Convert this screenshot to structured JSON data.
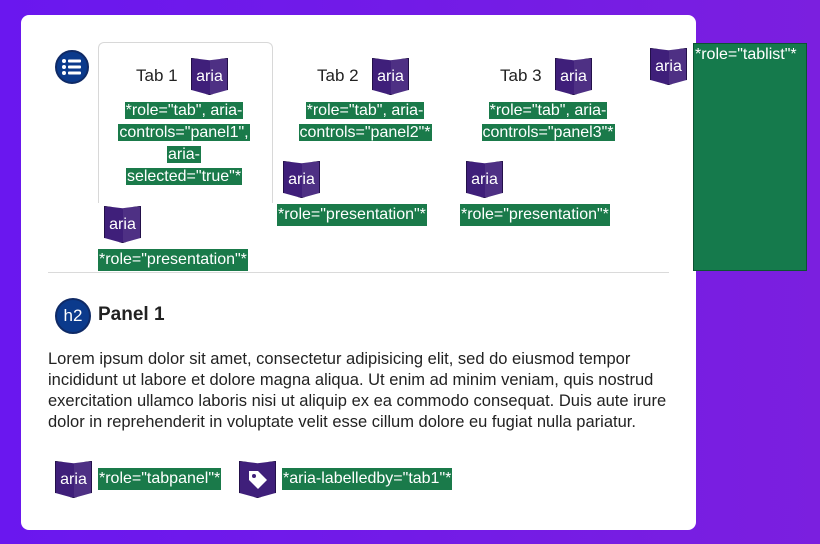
{
  "tabs": [
    {
      "label": "Tab 1",
      "annotation": "*role=\"tab\", aria-controls=\"panel1\", aria-selected=\"true\"*",
      "li_annotation": "*role=\"presentation\"*"
    },
    {
      "label": "Tab 2",
      "annotation": "*role=\"tab\", aria-controls=\"panel2\"*",
      "li_annotation": "*role=\"presentation\"*"
    },
    {
      "label": "Tab 3",
      "annotation": "*role=\"tab\", aria-controls=\"panel3\"*",
      "li_annotation": "*role=\"presentation\"*"
    }
  ],
  "aria_badge": "aria",
  "tablist_annotation": "*role=\"tablist\"*",
  "panel": {
    "heading_badge": "h2",
    "title": "Panel 1",
    "text": "Lorem ipsum dolor sit amet, consectetur adipisicing elit, sed do eiusmod tempor incididunt ut labore et dolore magna aliqua. Ut enim ad minim veniam, quis nostrud exercitation ullamco laboris nisi ut aliquip ex ea commodo consequat. Duis aute irure dolor in reprehenderit in voluptate velit esse cillum dolore eu fugiat nulla pariatur.",
    "role_annotation": "*role=\"tabpanel\"*",
    "label_annotation": "*aria-labelledby=\"tab1\"*"
  },
  "colors": {
    "background": "#6a17ef",
    "annotation_green": "#1a7a4a",
    "aria_purple": "#3f1f7a",
    "icon_blue": "#0b3a8c"
  },
  "icons": [
    "list-icon",
    "aria-icon",
    "h2-icon",
    "tag-icon"
  ]
}
